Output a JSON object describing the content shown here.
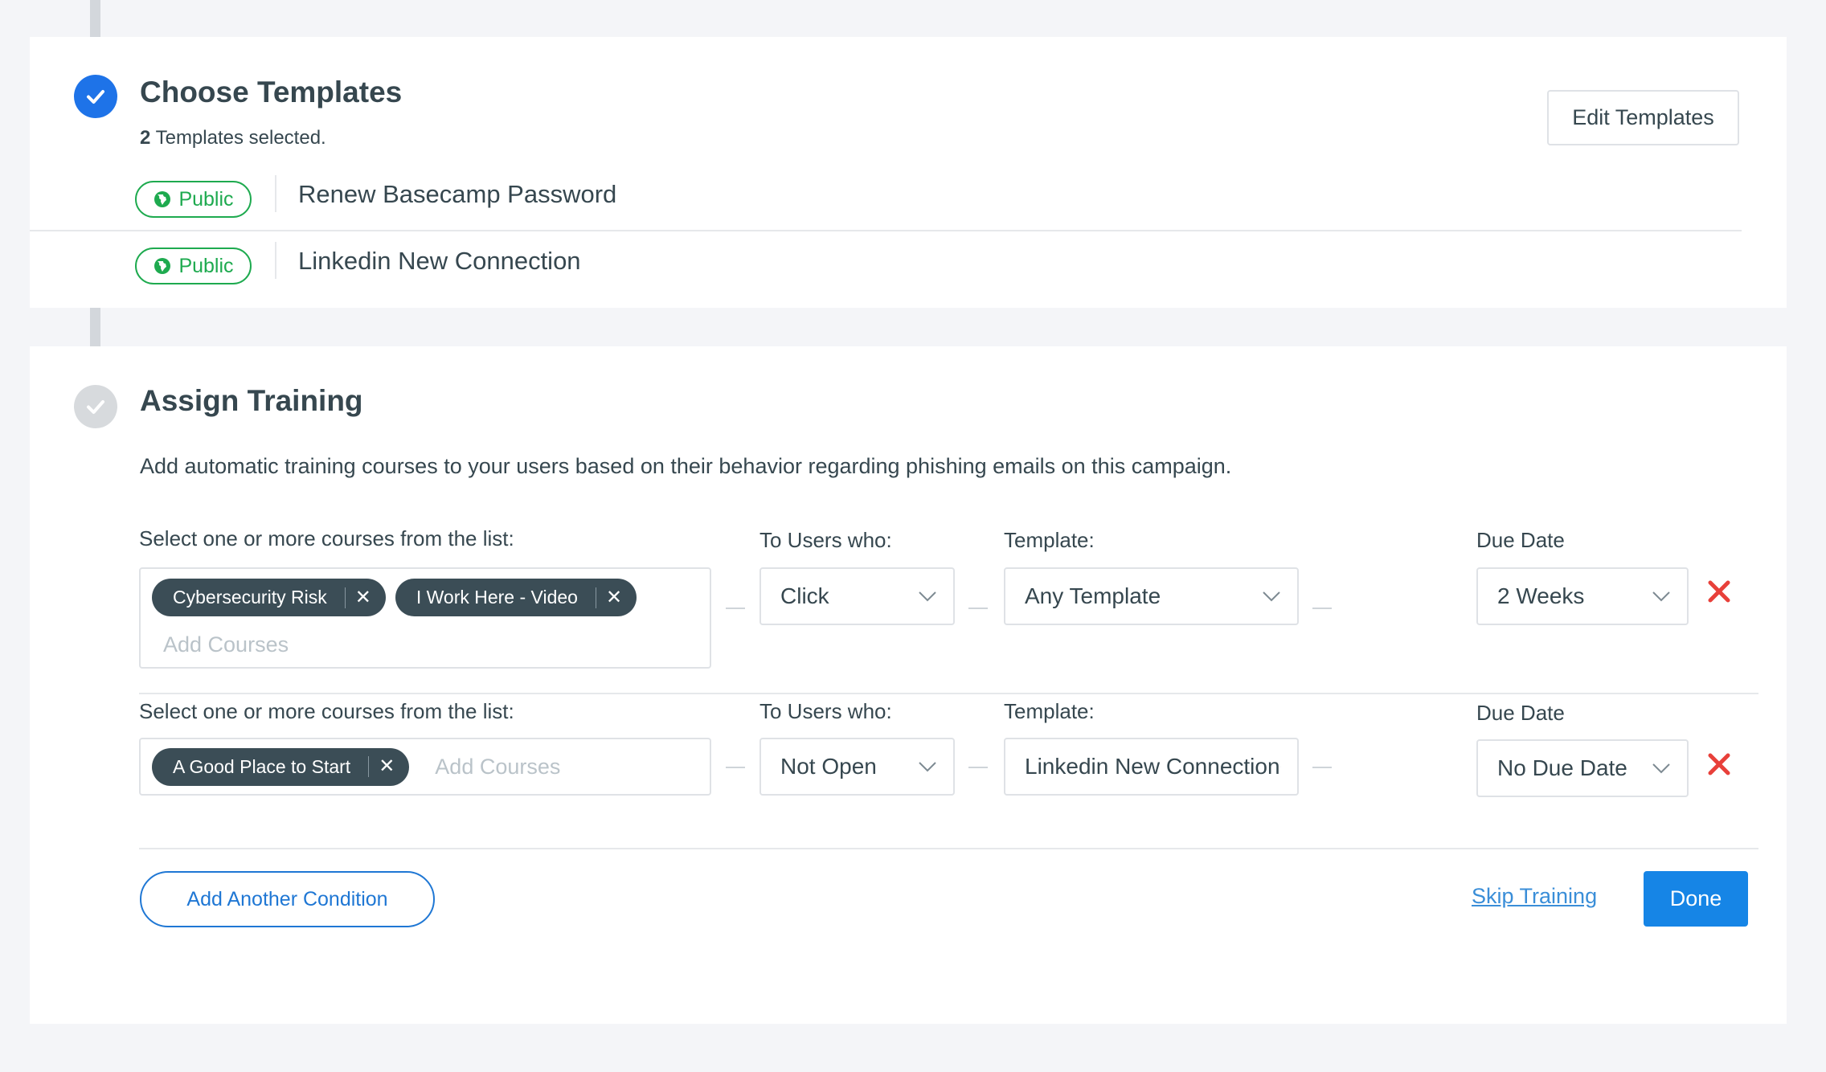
{
  "choose_templates": {
    "title": "Choose Templates",
    "selected_count": "2",
    "selected_text": " Templates selected.",
    "edit_button": "Edit Templates",
    "templates": [
      {
        "badge": "Public",
        "name": "Renew Basecamp Password"
      },
      {
        "badge": "Public",
        "name": "Linkedin New Connection"
      }
    ]
  },
  "assign_training": {
    "title": "Assign Training",
    "description": "Add automatic training courses to your users based on their behavior regarding phishing emails on this campaign.",
    "conditions": [
      {
        "courses_label": "Select one or more courses from the list:",
        "courses": [
          "Cybersecurity Risk",
          "I Work Here - Video"
        ],
        "add_courses_placeholder": "Add Courses",
        "users_label": "To Users who:",
        "users_value": "Click",
        "template_label": "Template:",
        "template_value": "Any Template",
        "due_label": "Due Date",
        "due_value": "2 Weeks"
      },
      {
        "courses_label": "Select one or more courses from the list:",
        "courses": [
          "A Good Place to Start"
        ],
        "add_courses_placeholder": "Add Courses",
        "users_label": "To Users who:",
        "users_value": "Not Open",
        "template_label": "Template:",
        "template_value": "Linkedin New Connection",
        "due_label": "Due Date",
        "due_value": "No Due Date"
      }
    ],
    "add_condition_button": "Add Another Condition",
    "skip_link": "Skip Training",
    "done_button": "Done"
  },
  "colors": {
    "primary_blue": "#1e73e8",
    "public_green": "#1eaa4f",
    "delete_red": "#e8403a",
    "chip_bg": "#3b4d56"
  },
  "icons": {
    "step_done": "check-circle-icon",
    "step_pending": "check-circle-icon",
    "badge": "globe-icon",
    "chip_remove": "close-icon",
    "select": "chevron-down-icon",
    "delete": "red-x-icon"
  }
}
